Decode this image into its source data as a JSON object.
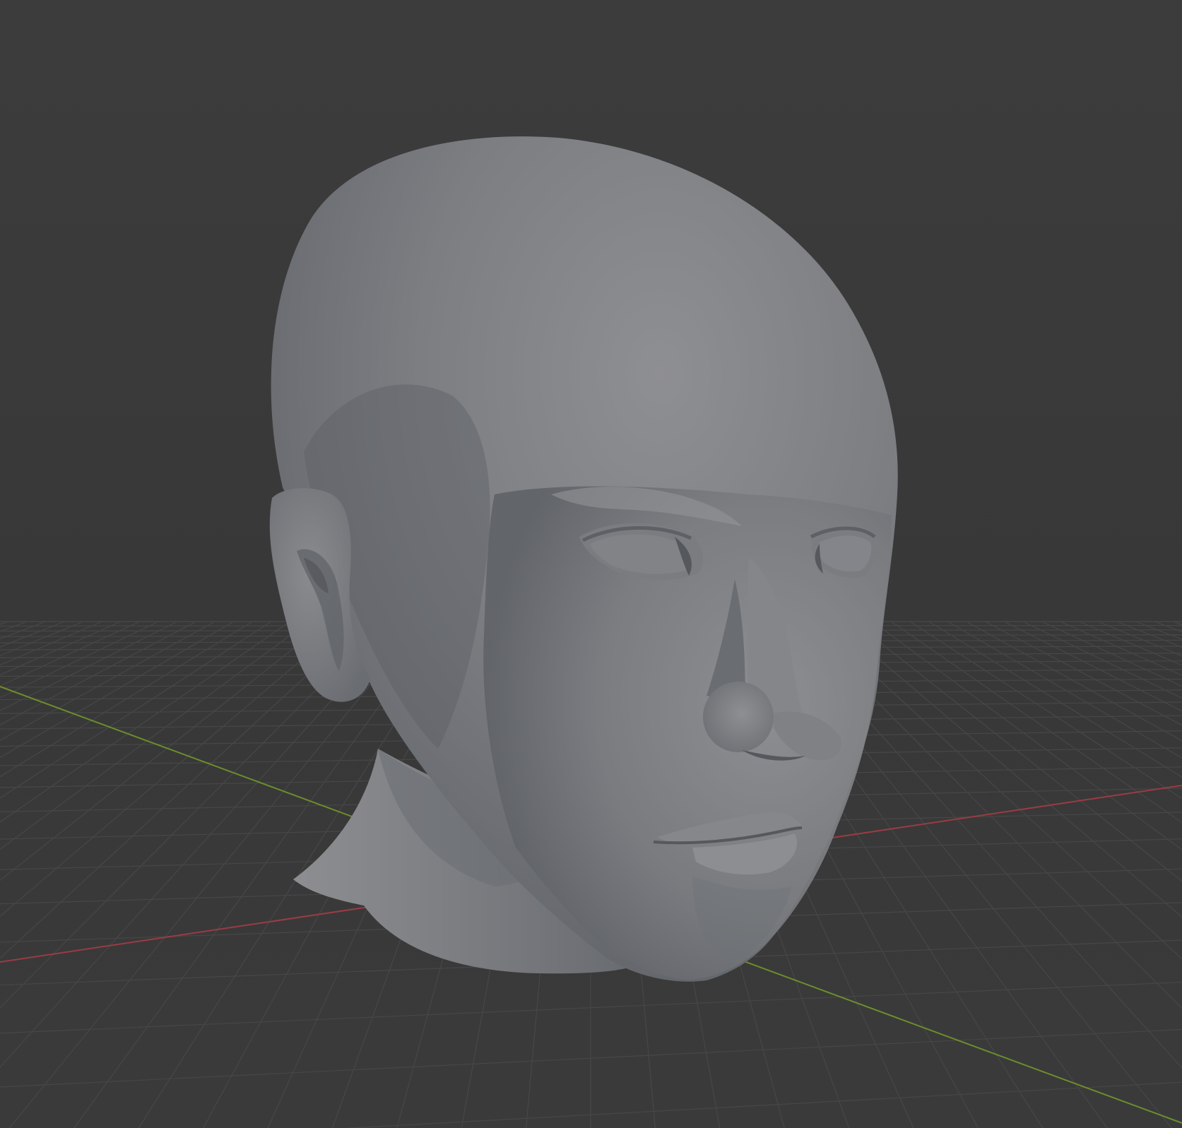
{
  "viewport": {
    "kind": "3d-viewport",
    "view": "perspective",
    "object": "sculpted-head",
    "shading": "solid",
    "floor_grid": true,
    "axes_visible": [
      "x",
      "y"
    ]
  },
  "colors": {
    "background": "#3a3a3a",
    "grid_line": "#484848",
    "x_axis": "#9b3b45",
    "y_axis": "#6c8d2c",
    "mesh_light": "#8c8d90",
    "mesh_mid": "#76787c",
    "mesh_dark": "#5a5d62"
  }
}
